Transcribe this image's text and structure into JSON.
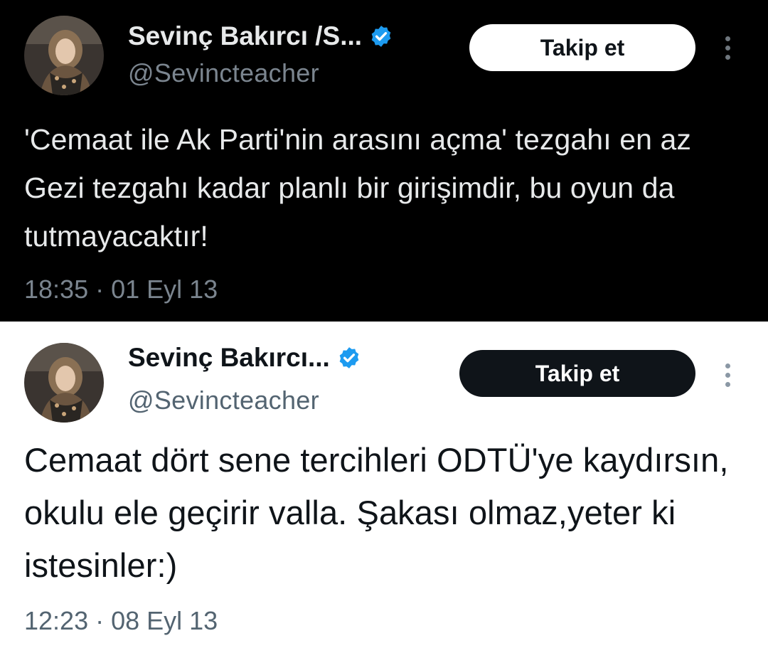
{
  "tweets": [
    {
      "theme": "dark",
      "display_name": "Sevinç Bakırcı /S...",
      "handle": "@Sevincteacher",
      "follow_label": "Takip et",
      "text": "'Cemaat ile Ak Parti'nin arasını açma' tezgahı en az Gezi tezgahı kadar planlı bir girişimdir, bu oyun da tutmayacaktır!",
      "timestamp": "18:35 · 01 Eyl 13",
      "icons": [
        "avatar",
        "verified-badge-icon",
        "more-options-icon"
      ]
    },
    {
      "theme": "light",
      "display_name": "Sevinç Bakırcı...",
      "handle": "@Sevincteacher",
      "follow_label": "Takip et",
      "text": "Cemaat dört sene tercihleri ODTÜ'ye kaydırsın, okulu ele geçirir valla. Şakası olmaz,yeter ki istesinler:)",
      "timestamp": "12:23 · 08 Eyl 13",
      "icons": [
        "avatar",
        "verified-badge-icon",
        "more-options-icon"
      ]
    }
  ],
  "colors": {
    "verified_blue": "#1d9bf0",
    "dark_bg": "#000000",
    "light_bg": "#ffffff"
  }
}
